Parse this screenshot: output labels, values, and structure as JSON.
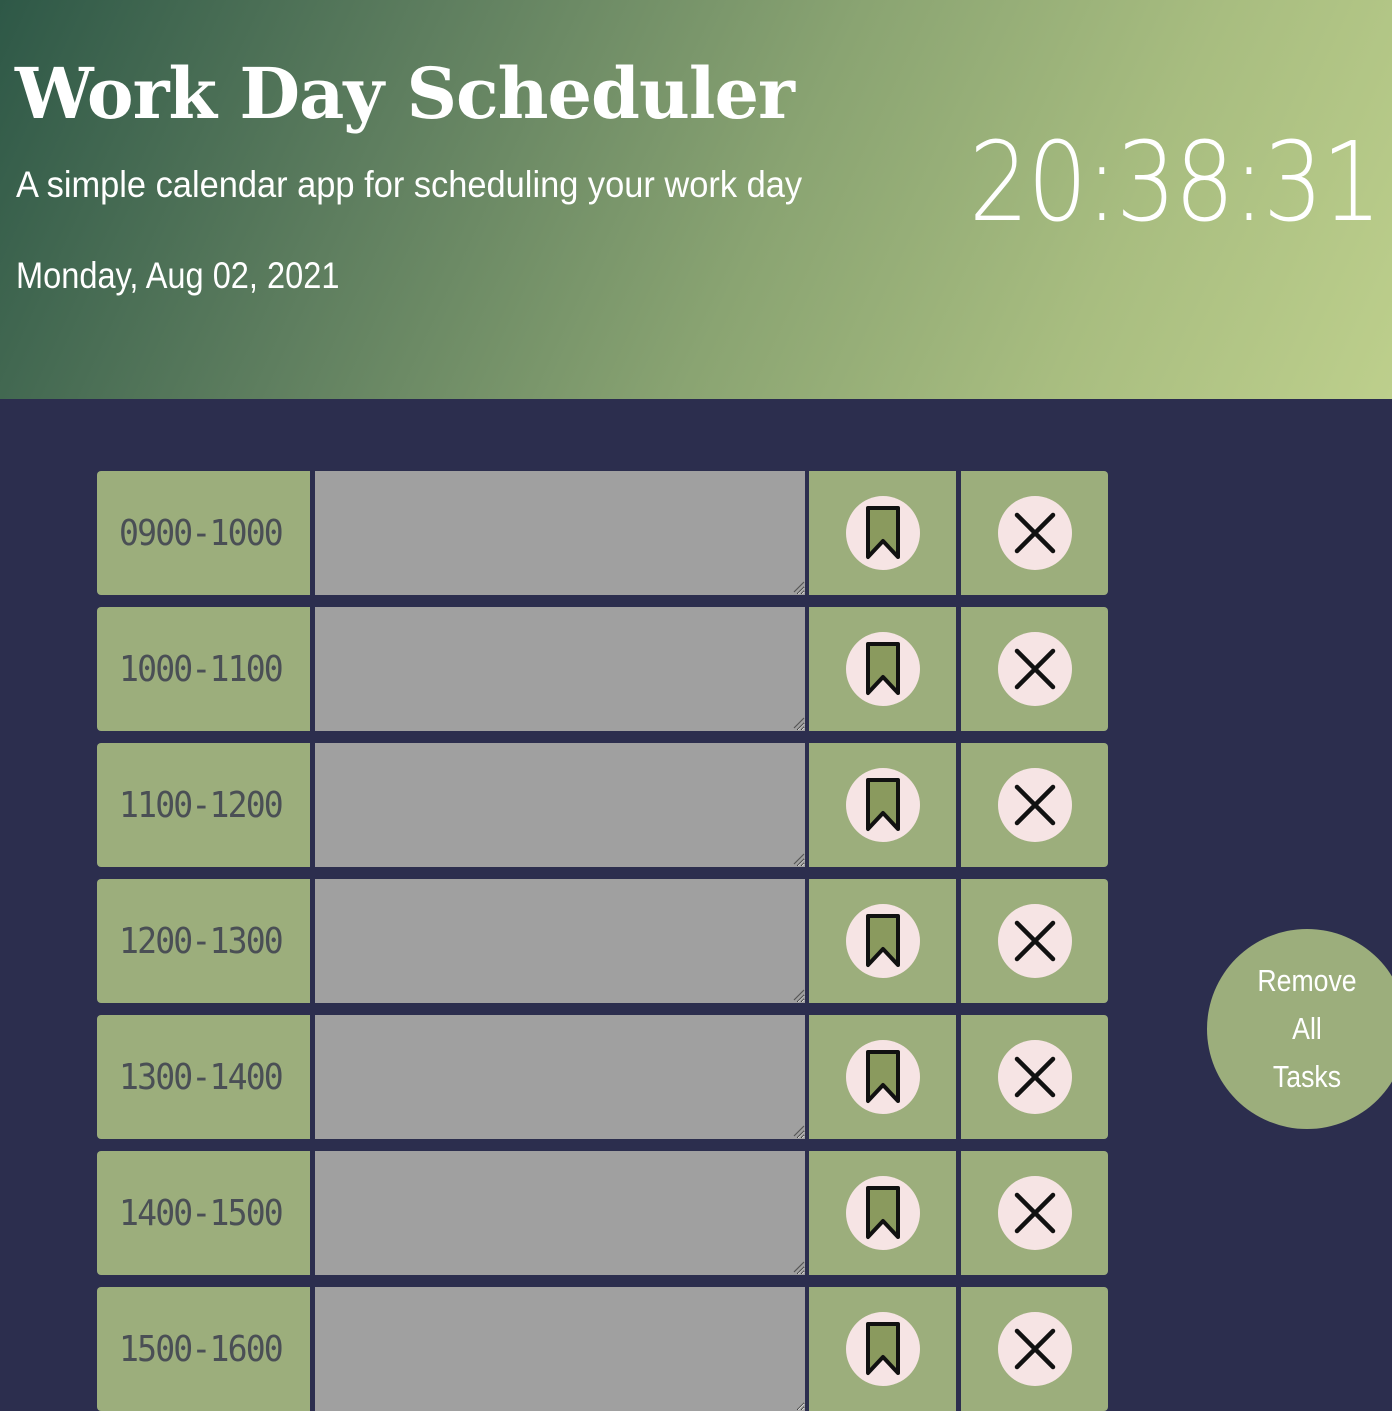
{
  "header": {
    "title": "Work Day Scheduler",
    "subtitle": "A simple calendar app for scheduling your work day",
    "date": "Monday, Aug 02, 2021",
    "clock": "20:38:31"
  },
  "rows": [
    {
      "hour": "0900-1000",
      "task": ""
    },
    {
      "hour": "1000-1100",
      "task": ""
    },
    {
      "hour": "1100-1200",
      "task": ""
    },
    {
      "hour": "1200-1300",
      "task": ""
    },
    {
      "hour": "1300-1400",
      "task": ""
    },
    {
      "hour": "1400-1500",
      "task": ""
    },
    {
      "hour": "1500-1600",
      "task": ""
    }
  ],
  "icons": {
    "save": "bookmark-icon",
    "delete": "close-icon"
  },
  "remove_all": {
    "line1": "Remove",
    "line2": "All",
    "line3": "Tasks"
  },
  "colors": {
    "background": "#2c2e4e",
    "row_accent": "#9cae7c",
    "textarea": "#a0a0a0",
    "icon_circle": "#f6e4e4",
    "bookmark_fill": "#8a9a5e"
  }
}
